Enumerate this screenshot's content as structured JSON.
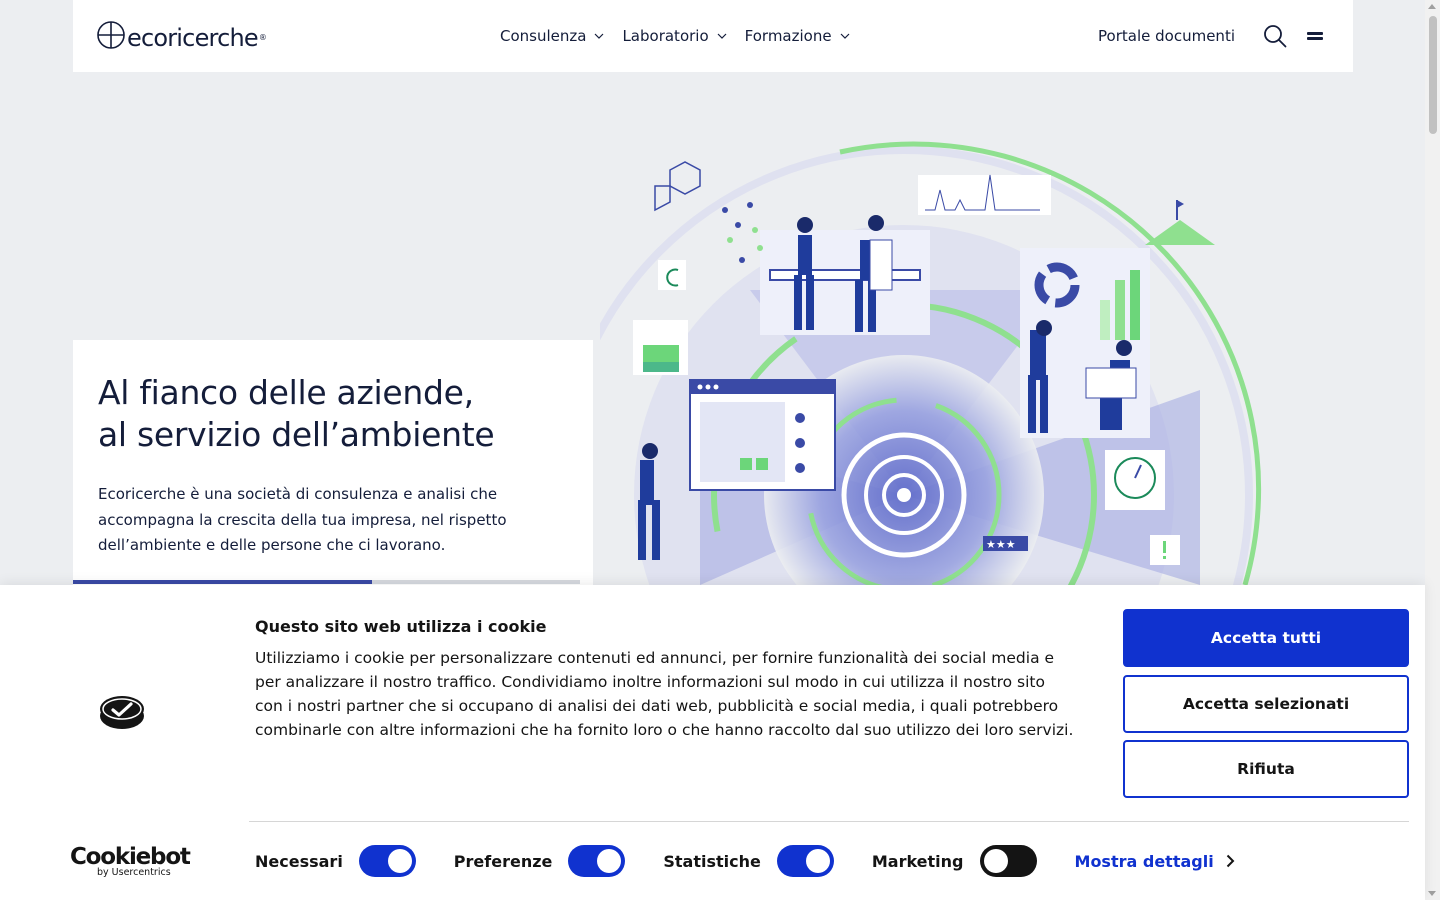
{
  "header": {
    "logo_text": "ecoricerche",
    "logo_reg": "®",
    "nav": [
      {
        "label": "Consulenza"
      },
      {
        "label": "Laboratorio"
      },
      {
        "label": "Formazione"
      }
    ],
    "portal_label": "Portale documenti"
  },
  "hero": {
    "title_line1": "Al fianco delle aziende,",
    "title_line2": "al servizio dell’ambiente",
    "description": "Ecoricerche è una società di consulenza e analisi che accompagna la crescita della tua impresa, nel rispetto dell’ambiente e delle persone che ci lavorano.",
    "progress": 0.59,
    "illustration_stars": "★★★"
  },
  "cookie": {
    "title": "Questo sito web utilizza i cookie",
    "text": "Utilizziamo i cookie per personalizzare contenuti ed annunci, per fornire funzionalità dei social media e per analizzare il nostro traffico. Condividiamo inoltre informazioni sul modo in cui utilizza il nostro sito con i nostri partner che si occupano di analisi dei dati web, pubblicità e social media, i quali potrebbero combinarle con altre informazioni che ha fornito loro o che hanno raccolto dal suo utilizzo dei loro servizi.",
    "accept_all": "Accetta tutti",
    "accept_selected": "Accetta selezionati",
    "reject": "Rifiuta",
    "brand_main": "Cookiebot",
    "brand_sub": "by Usercentrics",
    "toggles": [
      {
        "label": "Necessari",
        "on": true
      },
      {
        "label": "Preferenze",
        "on": true
      },
      {
        "label": "Statistiche",
        "on": true
      },
      {
        "label": "Marketing",
        "on": false
      }
    ],
    "details_label": "Mostra dettagli"
  },
  "colors": {
    "primary_blue": "#1032cf",
    "text_dark": "#141d3a",
    "illus_blue": "#3a4aa6",
    "illus_green": "#8fe08f",
    "page_bg": "#eceef1"
  }
}
